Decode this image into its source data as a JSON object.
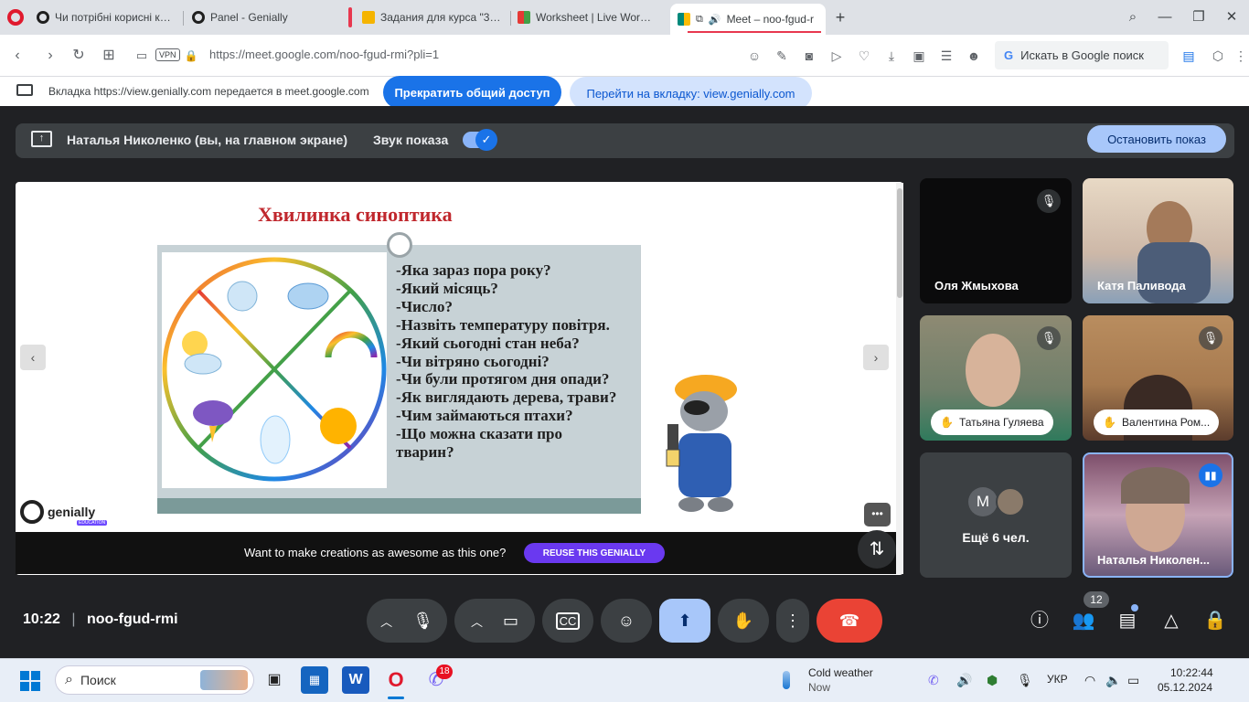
{
  "browser": {
    "tabs": [
      {
        "title": "Чи потрібні корисні копа",
        "fav_color": "#1f1f1f"
      },
      {
        "title": "Panel - Genially",
        "fav_color": "#1f1f1f"
      },
      {
        "title": "Задания для курса \"3 кла",
        "fav_color": "#f5b400"
      },
      {
        "title": "Worksheet | Live Workshee",
        "fav_color": "#2e7d32"
      },
      {
        "title": "Meet – noo-fgud-r",
        "fav_color": "#00897b"
      }
    ],
    "new_tab": "+",
    "url_host": "https://meet.google.com",
    "url_path": "/noo-fgud-rmi?pli=1",
    "vpn_badge": "VPN",
    "google_search_placeholder": "Искать в Google поиск"
  },
  "infobar": {
    "message": "Вкладка https://view.genially.com передается в meet.google.com",
    "stop_sharing": "Прекратить общий доступ",
    "switch_tab": "Перейти на вкладку: view.genially.com"
  },
  "meet": {
    "presenter_label": "Наталья Николенко (вы, на главном экране)",
    "sound_label": "Звук показа",
    "stop_presenting": "Остановить показ",
    "time": "10:22",
    "room": "noo-fgud-rmi",
    "participant_count": "12",
    "tiles": [
      {
        "name": "Оля Жмыхова"
      },
      {
        "name": "Катя Паливода"
      },
      {
        "name": "Татьяна Гуляева"
      },
      {
        "name": "Валентина Ром..."
      },
      {
        "name": "Ещё 6 чел.",
        "avatar_letter": "M"
      },
      {
        "name": "Наталья Николен..."
      }
    ]
  },
  "slide": {
    "title": "Хвилинка синоптика",
    "questions": [
      "-Яка зараз пора року?",
      "-Який місяць?",
      "-Число?",
      "-Назвіть температуру повітря.",
      "-Який сьогодні стан неба?",
      "-Чи вітряно сьогодні?",
      "-Чи були протягом дня опади?",
      "-Як виглядають дерева, трави?",
      "-Чим займаються птахи?",
      "-Що можна сказати про",
      "тварин?"
    ]
  },
  "genially": {
    "brand": "genially",
    "edu": "EDUCATION",
    "reuse_prompt": "Want to make creations as awesome as this one?",
    "reuse_button": "REUSE THIS GENIALLY"
  },
  "taskbar": {
    "search_placeholder": "Поиск",
    "viber_badge": "18",
    "weather_title": "Cold weather",
    "weather_sub": "Now",
    "language": "УКР",
    "clock_time": "10:22:44",
    "clock_date": "05.12.2024"
  }
}
